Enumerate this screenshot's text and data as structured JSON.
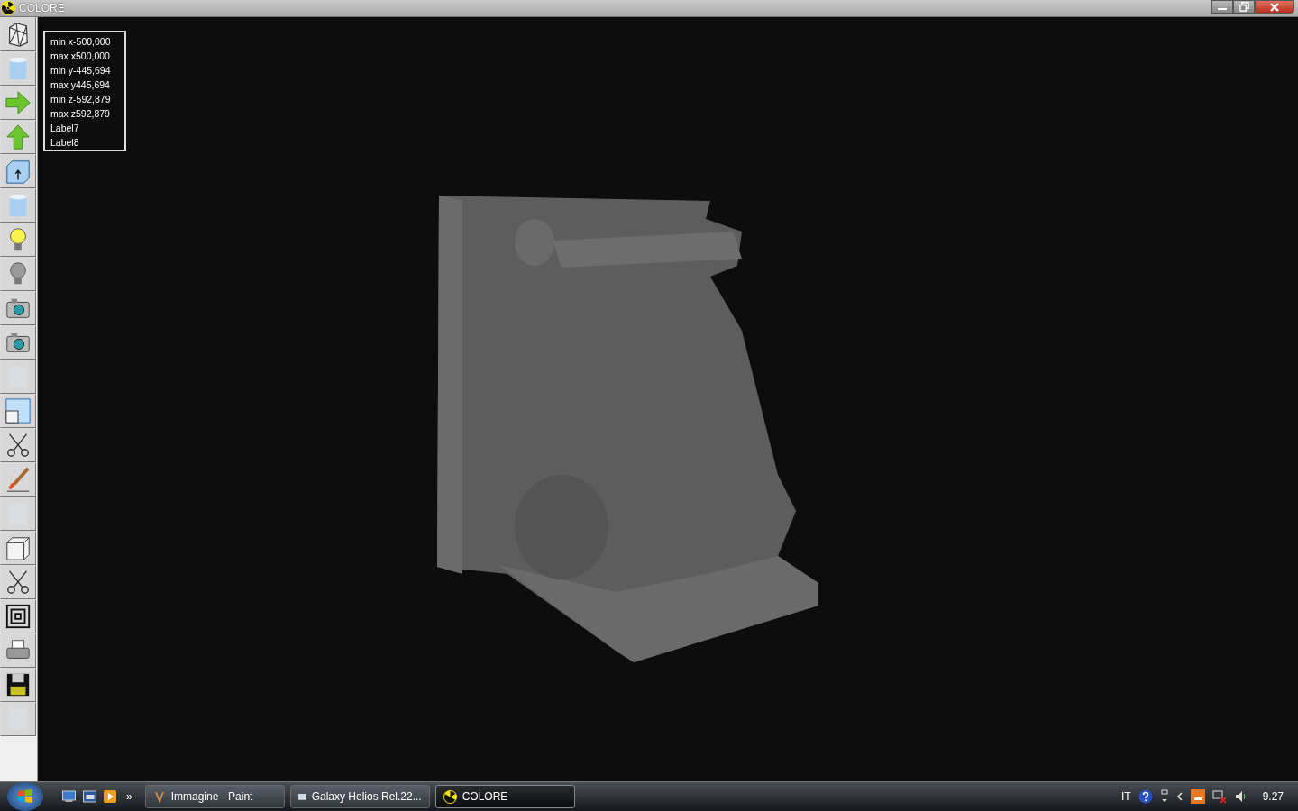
{
  "window": {
    "title": "COLORE"
  },
  "toolbar": [
    {
      "kind": "wireframe",
      "disabled": false
    },
    {
      "kind": "cylinder",
      "disabled": false
    },
    {
      "kind": "arrow-right",
      "disabled": false
    },
    {
      "kind": "arrow-up",
      "disabled": false
    },
    {
      "kind": "box-arrow",
      "disabled": false
    },
    {
      "kind": "cylinder",
      "disabled": false
    },
    {
      "kind": "bulb-on",
      "disabled": false
    },
    {
      "kind": "bulb-off",
      "disabled": false
    },
    {
      "kind": "camera",
      "disabled": false
    },
    {
      "kind": "camera",
      "disabled": false
    },
    {
      "kind": "blank",
      "disabled": true
    },
    {
      "kind": "window",
      "disabled": false
    },
    {
      "kind": "scissors",
      "disabled": false
    },
    {
      "kind": "brush",
      "disabled": false
    },
    {
      "kind": "blank",
      "disabled": true
    },
    {
      "kind": "cube",
      "disabled": false
    },
    {
      "kind": "scissors",
      "disabled": false
    },
    {
      "kind": "squares",
      "disabled": false
    },
    {
      "kind": "printer",
      "disabled": false
    },
    {
      "kind": "floppy",
      "disabled": false
    },
    {
      "kind": "blank",
      "disabled": true
    }
  ],
  "info_labels": [
    "min x-500,000",
    "max x500,000",
    "min y-445,694",
    "max y445,694",
    "min z-592,879",
    "max z592,879",
    "Label7",
    "Label8"
  ],
  "taskbar": {
    "more": "»",
    "tasks": [
      {
        "label": "Immagine - Paint",
        "selected": false
      },
      {
        "label": "Galaxy Helios  Rel.22...",
        "selected": false
      },
      {
        "label": "COLORE",
        "selected": true
      }
    ],
    "tray": {
      "language": "IT",
      "clock": "9.27"
    }
  }
}
